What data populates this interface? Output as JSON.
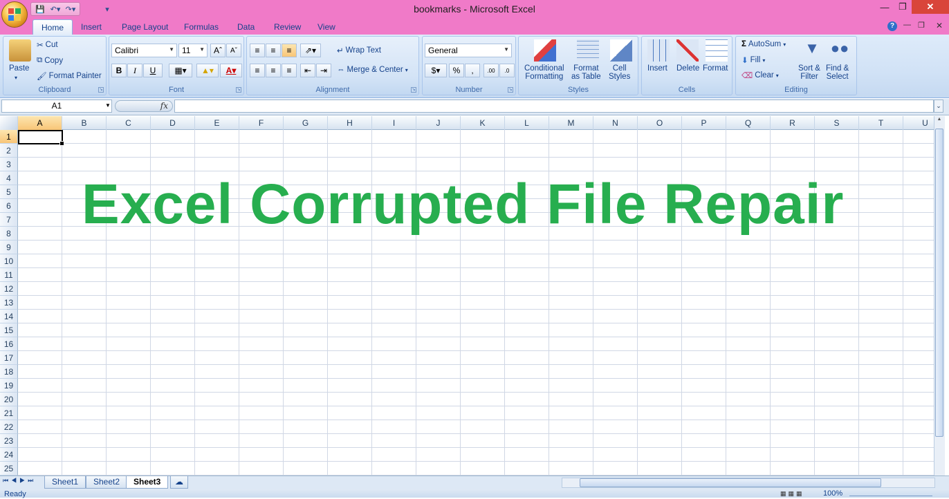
{
  "window": {
    "title": "bookmarks - Microsoft Excel"
  },
  "qat": {
    "save_icon": "save-icon",
    "undo_icon": "undo-icon",
    "redo_icon": "redo-icon"
  },
  "tabs": [
    "Home",
    "Insert",
    "Page Layout",
    "Formulas",
    "Data",
    "Review",
    "View"
  ],
  "clipboard": {
    "paste": "Paste",
    "cut": "Cut",
    "copy": "Copy",
    "format_painter": "Format Painter",
    "label": "Clipboard"
  },
  "font": {
    "family": "Calibri",
    "size": "11",
    "bold": "B",
    "italic": "I",
    "underline": "U",
    "color_glyph": "A",
    "label": "Font"
  },
  "alignment": {
    "wrap_text": "Wrap Text",
    "merge_center": "Merge & Center",
    "label": "Alignment"
  },
  "number": {
    "format": "General",
    "currency": "$",
    "percent": "%",
    "comma": ",",
    "label": "Number"
  },
  "styles": {
    "conditional_1": "Conditional",
    "conditional_2": "Formatting",
    "format_table_1": "Format",
    "format_table_2": "as Table",
    "cell_styles_1": "Cell",
    "cell_styles_2": "Styles",
    "label": "Styles"
  },
  "cells": {
    "insert": "Insert",
    "delete": "Delete",
    "format": "Format",
    "label": "Cells"
  },
  "editing": {
    "autosum": "AutoSum",
    "fill": "Fill",
    "clear": "Clear",
    "sort_1": "Sort &",
    "sort_2": "Filter",
    "find_1": "Find &",
    "find_2": "Select",
    "label": "Editing"
  },
  "formula_bar": {
    "name_box": "A1",
    "fx": "fx",
    "content": ""
  },
  "columns": [
    "A",
    "B",
    "C",
    "D",
    "E",
    "F",
    "G",
    "H",
    "I",
    "J",
    "K",
    "L",
    "M",
    "N",
    "O",
    "P",
    "Q",
    "R",
    "S",
    "T",
    "U"
  ],
  "rows": [
    "1",
    "2",
    "3",
    "4",
    "5",
    "6",
    "7",
    "8",
    "9",
    "10",
    "11",
    "12",
    "13",
    "14",
    "15",
    "16",
    "17",
    "18",
    "19",
    "20",
    "21",
    "22",
    "23",
    "24",
    "25"
  ],
  "overlay_text": "Excel Corrupted File Repair",
  "sheets": [
    "Sheet1",
    "Sheet2",
    "Sheet3"
  ],
  "active_sheet": "Sheet3",
  "status": {
    "text": "Ready",
    "zoom": "100%"
  },
  "colors": {
    "title_bar": "#f07ac8",
    "overlay_text": "#27ae4f",
    "ribbon": "#d1e2f6",
    "close_button": "#d9453a"
  }
}
